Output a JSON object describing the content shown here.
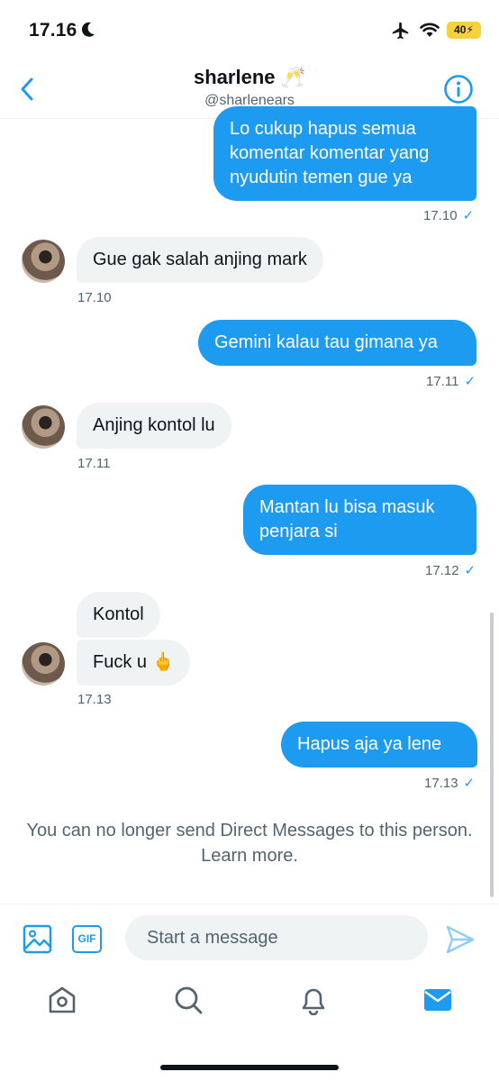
{
  "status_bar": {
    "time": "17.16",
    "battery": "40⚡"
  },
  "header": {
    "title": "sharlene 🥂",
    "handle": "@sharlenears"
  },
  "messages": [
    {
      "direction": "out",
      "text": "Lo cukup hapus semua\nkomentar komentar yang\nnyudutin temen gue ya",
      "time": "17.10",
      "check": "✓"
    },
    {
      "direction": "in",
      "text": "Gue gak salah anjing mark",
      "time": "17.10"
    },
    {
      "direction": "out",
      "text": "Gemini kalau tau gimana ya",
      "time": "17.11",
      "check": "✓"
    },
    {
      "direction": "in",
      "text": "Anjing kontol lu",
      "time": "17.11"
    },
    {
      "direction": "out",
      "text": "Mantan lu bisa masuk\npenjara si",
      "time": "17.12",
      "check": "✓"
    },
    {
      "direction": "in",
      "text": "Kontol"
    },
    {
      "direction": "in",
      "text": "Fuck u 🖕",
      "time": "17.13"
    },
    {
      "direction": "out",
      "text": "Hapus aja ya lene",
      "time": "17.13",
      "check": "✓"
    }
  ],
  "notice": "You can no longer send Direct Messages to this person. Learn more.",
  "composer": {
    "gif_label": "GIF",
    "placeholder": "Start a message"
  },
  "tabs": [
    "home-icon",
    "search-icon",
    "notifications-icon",
    "messages-icon"
  ],
  "colors": {
    "accent": "#1d9bf0",
    "incoming_bubble": "#eff3f4",
    "battery": "#f4d13d",
    "secondary_text": "#536471"
  }
}
